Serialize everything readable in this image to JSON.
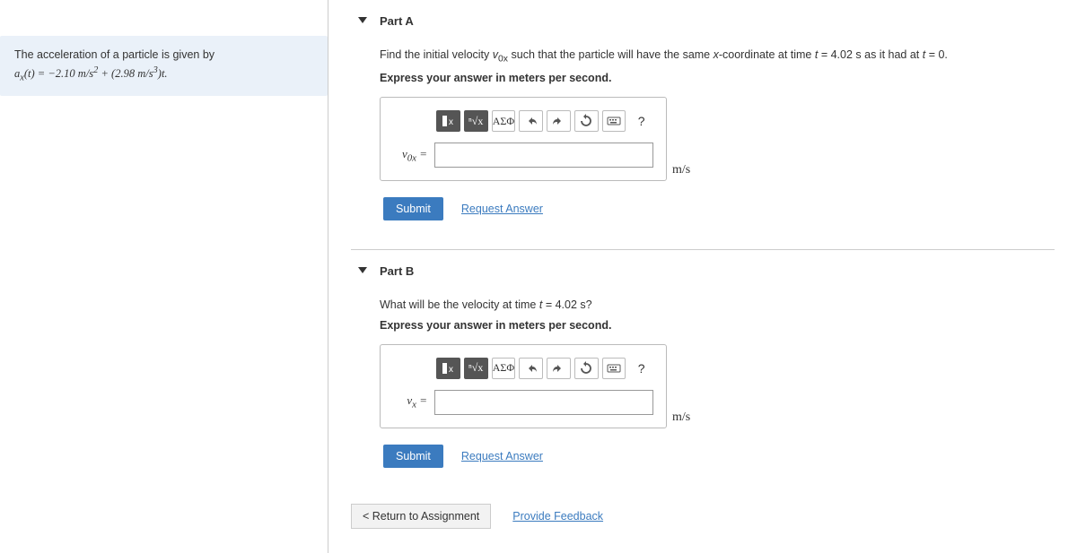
{
  "problem": {
    "line1": "The acceleration of a particle is given by",
    "line2_html": "a<sub>x</sub>(t) = −2.10 m/s<sup>2</sup> + (2.98 m/s<sup>3</sup>)t."
  },
  "parts": [
    {
      "title": "Part A",
      "prompt_html": "Find the initial velocity <i>v</i><sub>0x</sub> such that the particle will have the same <i>x</i>-coordinate at time <i>t</i> = 4.02 s as it had at <i>t</i> = 0.",
      "express": "Express your answer in meters per second.",
      "var_label_html": "v<sub>0x</sub> =",
      "unit": "m/s",
      "submit": "Submit",
      "request": "Request Answer",
      "toolbar": {
        "sqrt": "√",
        "greek": "ΑΣΦ",
        "help": "?"
      }
    },
    {
      "title": "Part B",
      "prompt_html": "What will be the velocity at time <i>t</i> = 4.02 s?",
      "express": "Express your answer in meters per second.",
      "var_label_html": "v<sub>x</sub> =",
      "unit": "m/s",
      "submit": "Submit",
      "request": "Request Answer",
      "toolbar": {
        "sqrt": "√",
        "greek": "ΑΣΦ",
        "help": "?"
      }
    }
  ],
  "footer": {
    "return": "< Return to Assignment",
    "feedback": "Provide Feedback"
  }
}
